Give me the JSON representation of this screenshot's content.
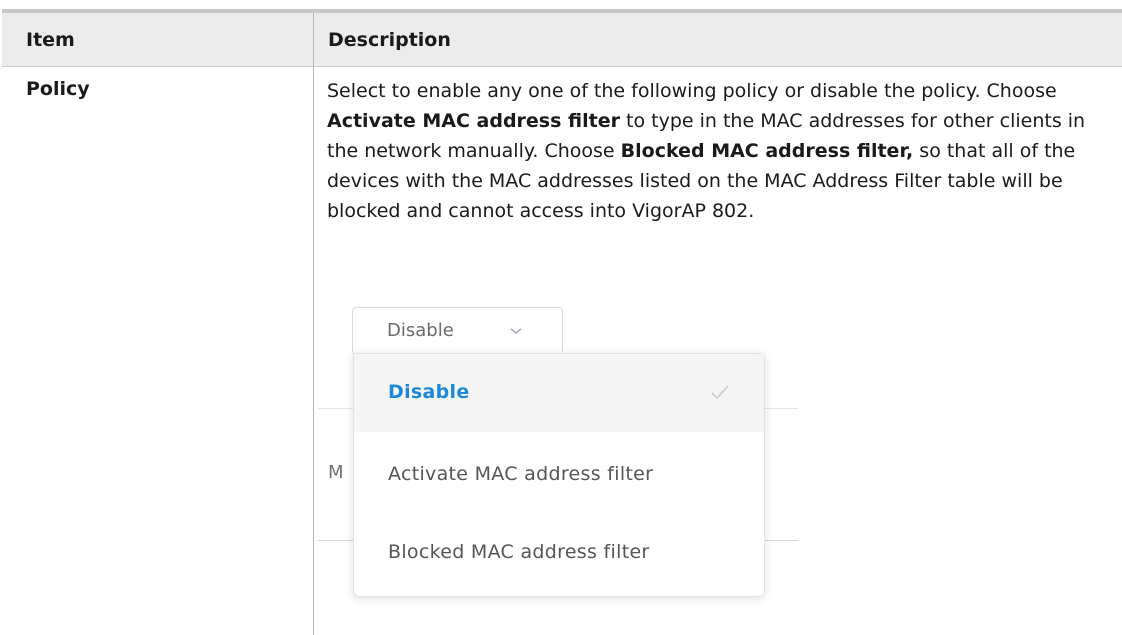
{
  "table": {
    "header": {
      "item": "Item",
      "description": "Description"
    },
    "rows": [
      {
        "item": "Policy",
        "description": {
          "intro": "Select to enable any one of the following policy or disable the policy. Choose ",
          "bold1": "Activate MAC address filter",
          "mid": " to type in the MAC addresses for other clients in the network manually. Choose ",
          "bold2": "Blocked MAC address filter,",
          "end": " so that all of the devices with the MAC addresses listed on the MAC Address Filter table will be blocked and cannot access into VigorAP 802."
        }
      }
    ]
  },
  "policy_dropdown": {
    "selected": "Disable",
    "options": [
      {
        "label": "Disable",
        "selected": true
      },
      {
        "label": "Activate MAC address filter",
        "selected": false
      },
      {
        "label": "Blocked MAC address filter",
        "selected": false
      }
    ],
    "background_fragment": "M"
  },
  "colors": {
    "accent": "#1e88d6",
    "header_bg": "#ececec"
  },
  "icons": {
    "dropdown": "chevron-down-icon",
    "selected": "check-icon"
  }
}
